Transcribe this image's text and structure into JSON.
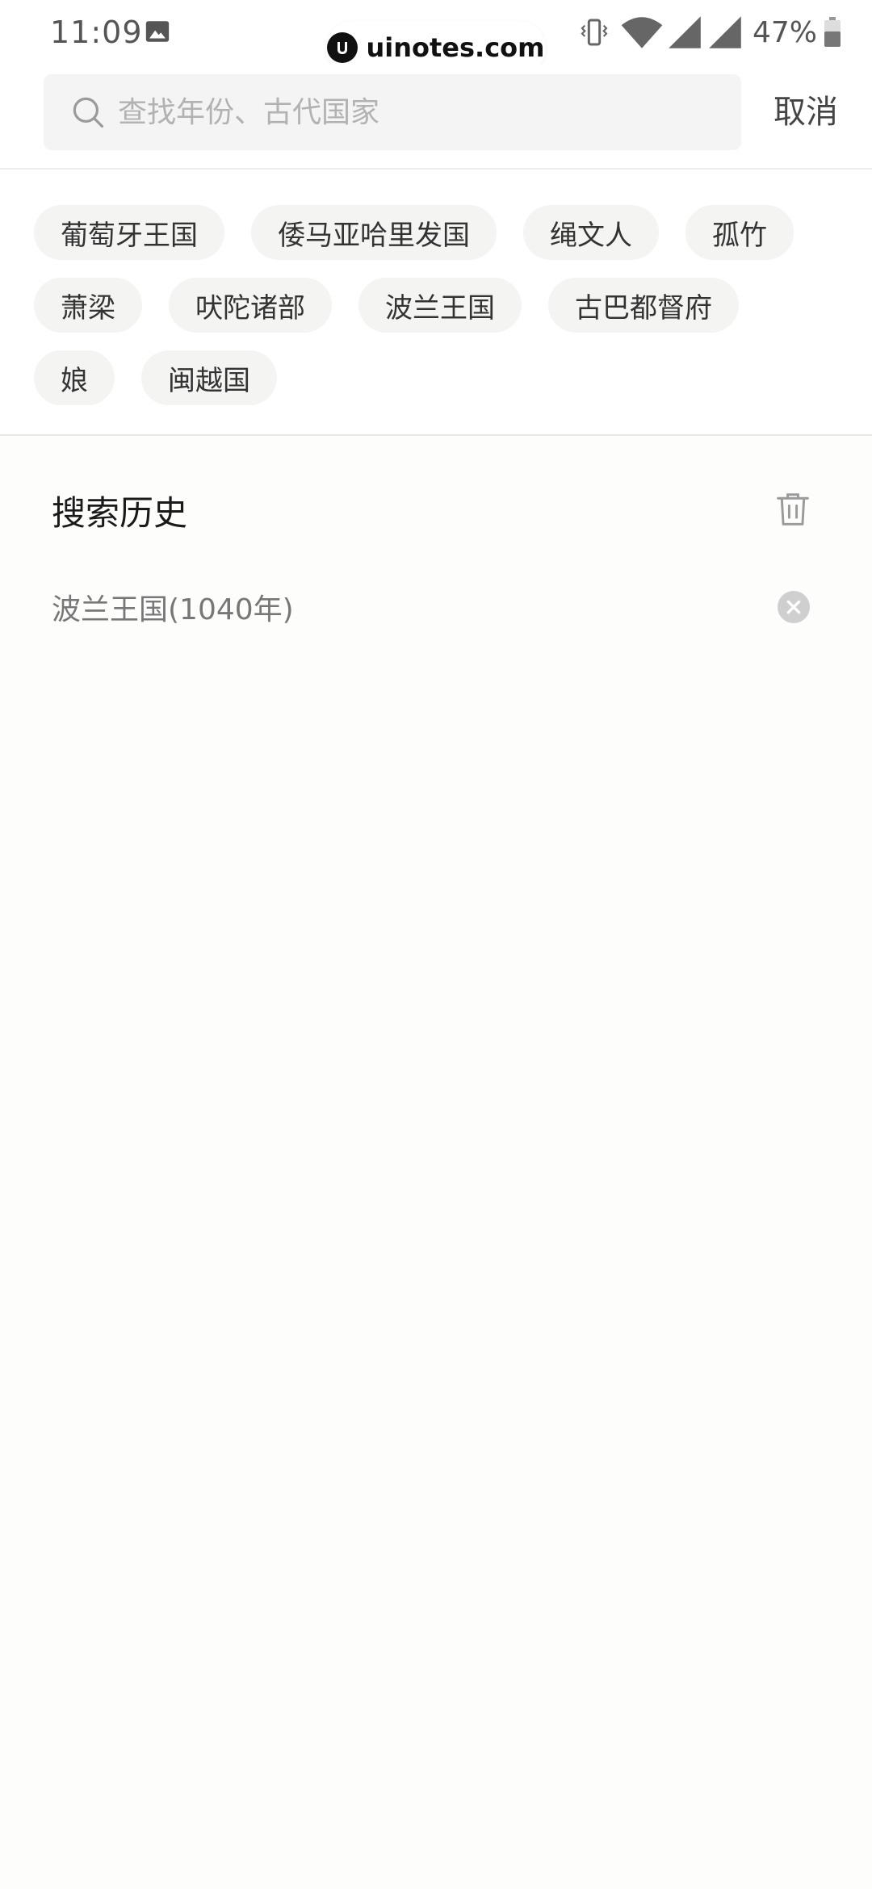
{
  "status_bar": {
    "time": "11:09",
    "battery_percent": "47%",
    "icons": [
      "gallery-icon",
      "vibrate-icon",
      "wifi-icon",
      "signal-icon",
      "signal-icon",
      "battery-icon"
    ]
  },
  "watermark": {
    "text": "uinotes.com",
    "logo_letter": "U"
  },
  "search": {
    "placeholder": "查找年份、古代国家",
    "value": "",
    "cancel_label": "取消",
    "icon": "search-icon"
  },
  "hot_tags": [
    "葡萄牙王国",
    "倭马亚哈里发国",
    "绳文人",
    "孤竹",
    "萧梁",
    "吠陀诸部",
    "波兰王国",
    "古巴都督府",
    "娘",
    "闽越国"
  ],
  "history": {
    "title": "搜索历史",
    "clear_icon": "trash-icon",
    "items": [
      {
        "text": "波兰王国(1040年)",
        "remove_icon": "clear-icon"
      }
    ]
  },
  "colors": {
    "background": "#fdfdfc",
    "surface": "#ffffff",
    "tag_background": "#f4f4f3",
    "search_background": "#f4f4f4",
    "placeholder": "#b2b2b2",
    "history_text": "#777777",
    "icon_gray": "#9a9a9a"
  }
}
